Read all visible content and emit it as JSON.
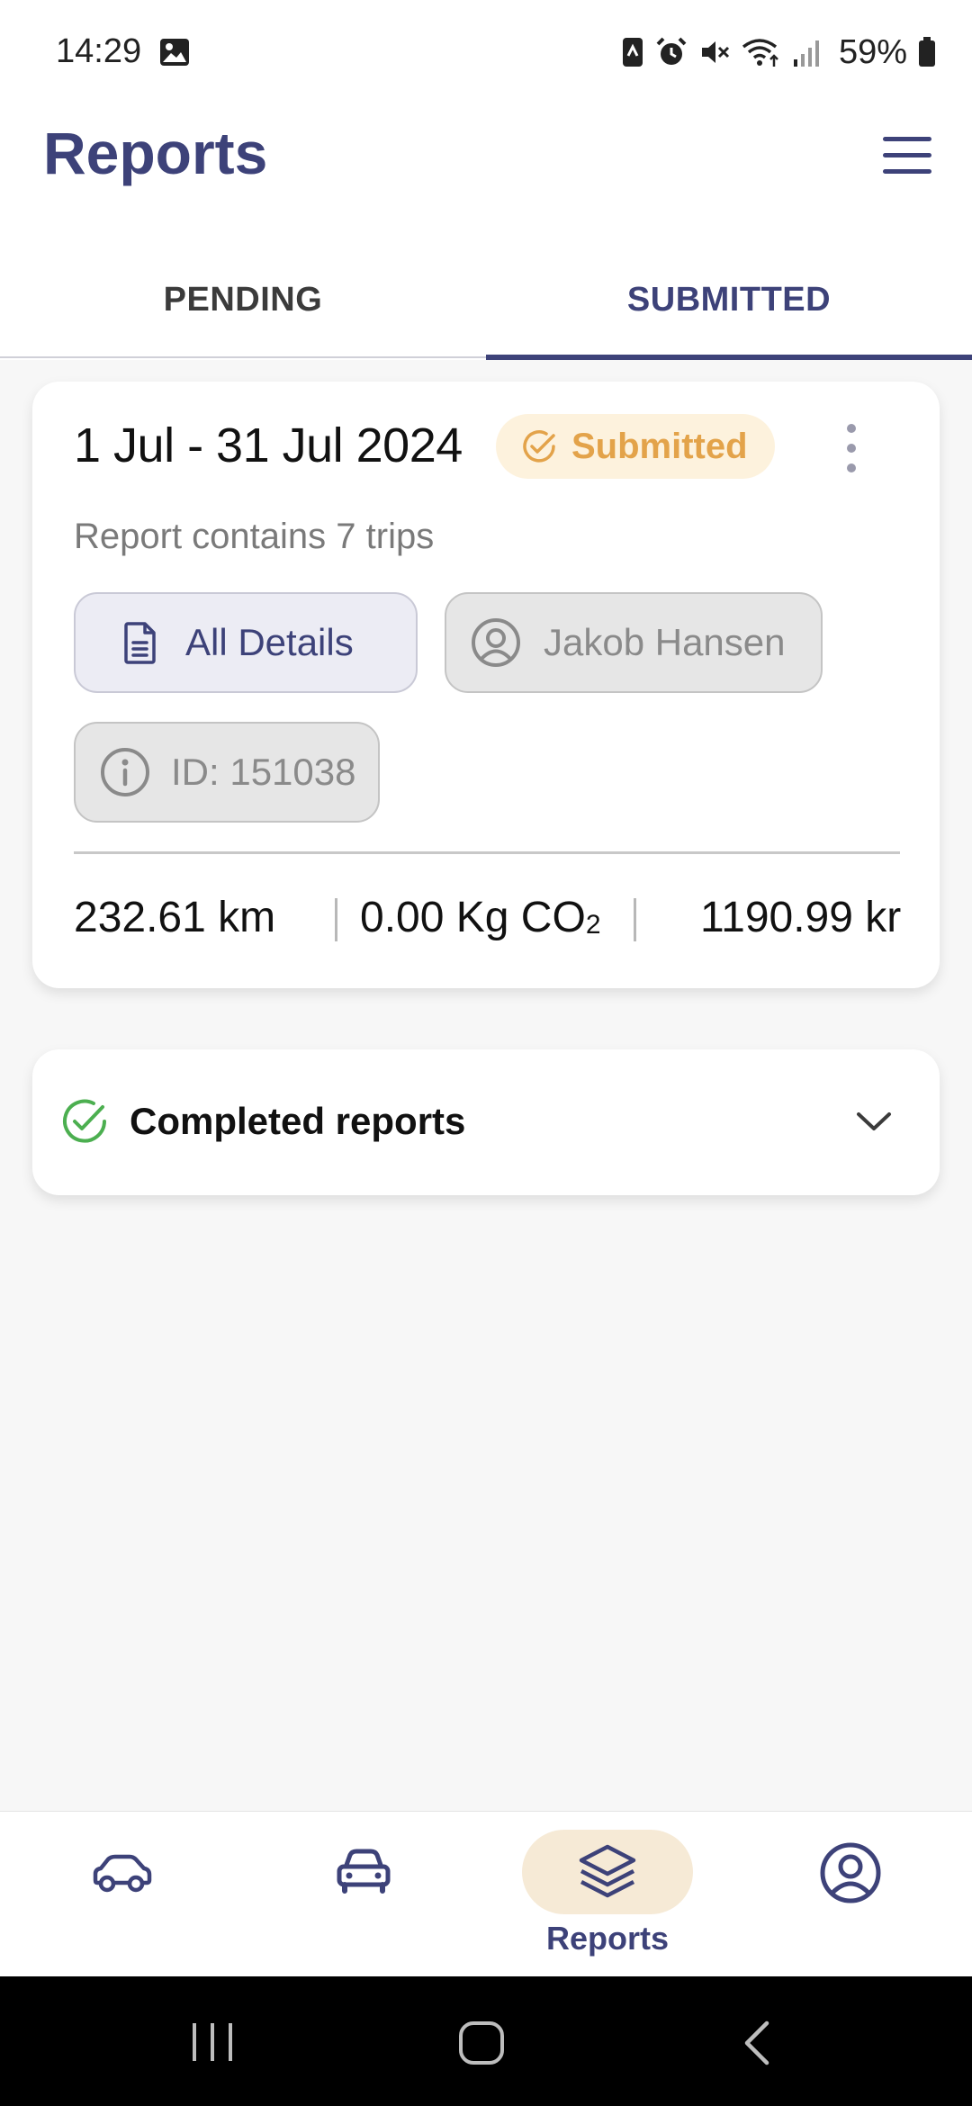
{
  "status_bar": {
    "time": "14:29",
    "battery": "59%"
  },
  "header": {
    "title": "Reports"
  },
  "tabs": [
    {
      "label": "PENDING",
      "active": false
    },
    {
      "label": "SUBMITTED",
      "active": true
    }
  ],
  "report": {
    "date_range": "1 Jul - 31 Jul 2024",
    "status": "Submitted",
    "trips_text": "Report contains 7 trips",
    "details_label": "All Details",
    "user_name": "Jakob Hansen",
    "id_text": "ID: 151038",
    "distance": "232.61 km",
    "co2": "0.00 Kg CO",
    "co2_sub": "2",
    "cost": "1190.99 kr"
  },
  "completed": {
    "label": "Completed reports"
  },
  "bottom_nav": {
    "items": [
      "car-outline-icon",
      "car-front-icon",
      "layers-icon",
      "profile-icon"
    ],
    "active_label": "Reports"
  },
  "colors": {
    "brand": "#3d4279",
    "badge_bg": "#fdf2dd",
    "badge_text": "#e3a34a",
    "success": "#4caf50",
    "nav_pill": "#f6ead6"
  }
}
